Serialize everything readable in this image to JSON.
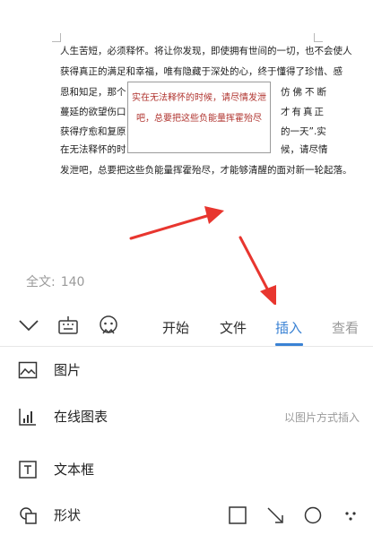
{
  "document": {
    "lines": [
      "人生苦短，必须释怀。将让你发现，即使拥有世间的一切，也不会使人",
      "获得真正的满足和幸福，唯有隐藏于深处的心，终于懂得了珍惜、感",
      "恩和知足，那个",
      "蔓延的欲望伤口，",
      "获得疗愈和复原",
      "在无法释怀的时",
      "发泄吧，总要把这些负能量挥霍殆尽，才能够清醒的面对新一轮起落。"
    ],
    "right_fragments": [
      "仿佛不断",
      "才有真正",
      "的一天”.实",
      "候，请尽情"
    ],
    "textbox": {
      "line1": "实在无法释怀的时候，请尽情发泄",
      "line2": "吧，总要把这些负能量挥霍殆尽"
    }
  },
  "word_count": {
    "label": "全文:",
    "value": "140"
  },
  "toolbar": {
    "icons": [
      "chevron-down-icon",
      "keyboard-icon",
      "voice-assistant-icon"
    ],
    "tabs": [
      {
        "label": "开始",
        "active": false
      },
      {
        "label": "文件",
        "active": false
      },
      {
        "label": "插入",
        "active": true
      },
      {
        "label": "查看",
        "active": false
      }
    ]
  },
  "insert_panel": {
    "items": [
      {
        "label": "图片",
        "icon": "picture-icon"
      },
      {
        "label": "在线图表",
        "icon": "bar-chart-icon",
        "hint": "以图片方式插入"
      },
      {
        "label": "文本框",
        "icon": "textbox-icon"
      },
      {
        "label": "形状",
        "icon": "shape-icon"
      }
    ],
    "shape_options": [
      "square-shape-icon",
      "arrow-shape-icon",
      "circle-shape-icon",
      "more-shapes-icon"
    ]
  },
  "colors": {
    "accent": "#3a82d4",
    "annotation_arrow": "#e8362f",
    "textbox_text": "#b0342f",
    "muted_text": "#9a9a9a"
  }
}
